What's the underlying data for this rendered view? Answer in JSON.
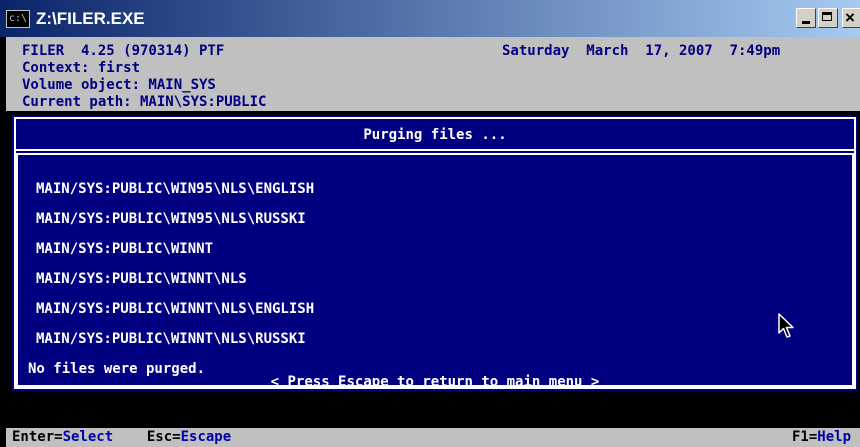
{
  "window": {
    "title": "Z:\\FILER.EXE",
    "icon_name": "console-icon",
    "icon_glyph": "c:\\"
  },
  "header": {
    "line1": "FILER  4.25 (970314) PTF",
    "line2": "Context: first",
    "line3": "Volume object: MAIN_SYS",
    "line4": "Current path: MAIN\\SYS:PUBLIC",
    "datetime": "Saturday  March  17, 2007  7:49pm"
  },
  "dialog": {
    "title": "Purging files ...",
    "paths": [
      "MAIN/SYS:PUBLIC\\WIN95\\NLS\\ENGLISH",
      "MAIN/SYS:PUBLIC\\WIN95\\NLS\\RUSSKI",
      "MAIN/SYS:PUBLIC\\WINNT",
      "MAIN/SYS:PUBLIC\\WINNT\\NLS",
      "MAIN/SYS:PUBLIC\\WINNT\\NLS\\ENGLISH",
      "MAIN/SYS:PUBLIC\\WINNT\\NLS\\RUSSKI"
    ],
    "message": "No files were purged.",
    "hint": "< Press Escape to return to main menu >"
  },
  "statusbar": {
    "enter_key": "Enter=",
    "enter_action": "Select",
    "esc_key": "Esc=",
    "esc_action": "Escape",
    "help_key": "F1=",
    "help_action": "Help"
  },
  "colors": {
    "console_blue": "#000080",
    "panel_gray": "#c0c0c0",
    "action_blue": "#0000aa"
  }
}
